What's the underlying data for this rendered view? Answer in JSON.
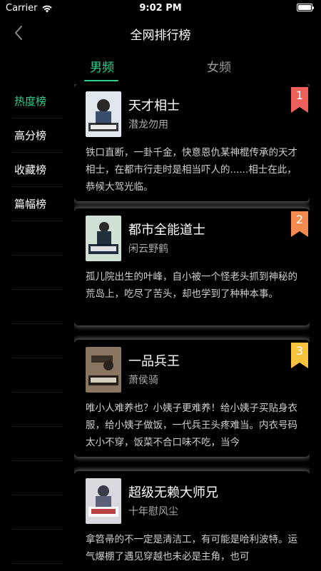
{
  "status": {
    "carrier": "Carrier",
    "time": "9:02 PM"
  },
  "nav": {
    "title": "全网排行榜"
  },
  "tabs": {
    "male": "男频",
    "female": "女频"
  },
  "sidebar": {
    "items": [
      "热度榜",
      "高分榜",
      "收藏榜",
      "篇幅榜"
    ]
  },
  "books": [
    {
      "title": "天才相士",
      "author": "潜龙勿用",
      "desc": "铁口直断，一卦千金，快意恩仇某神棍传承的天才相士，在都市行走时是相当吓人的......相士在此，恭候大驾光临。",
      "rank": "1"
    },
    {
      "title": "都市全能道士",
      "author": "闲云野鹤",
      "desc": "孤儿院出生的叶峰，自小被一个怪老头抓到神秘的荒岛上，吃尽了苦头，却也学到了种种本事。",
      "rank": "2"
    },
    {
      "title": "一品兵王",
      "author": "萧侯骑",
      "desc": "唯小人难养也？小姨子更难养！给小姨子买贴身衣服，给小姨子做饭，一代兵王头疼难当。内衣号码太小不穿，饭菜不合口味不吃，当今",
      "rank": "3"
    },
    {
      "title": "超级无赖大师兄",
      "author": "十年慰风尘",
      "desc": "拿笤帚的不一定是清洁工，有可能是哈利波特。运气爆棚了遇见穿越也未必是主角，也可",
      "rank": ""
    }
  ],
  "colors": {
    "accent": "#2dd28c",
    "rank1": "#f0605a",
    "rank2": "#f58a4e",
    "rank3": "#f7c23c"
  }
}
